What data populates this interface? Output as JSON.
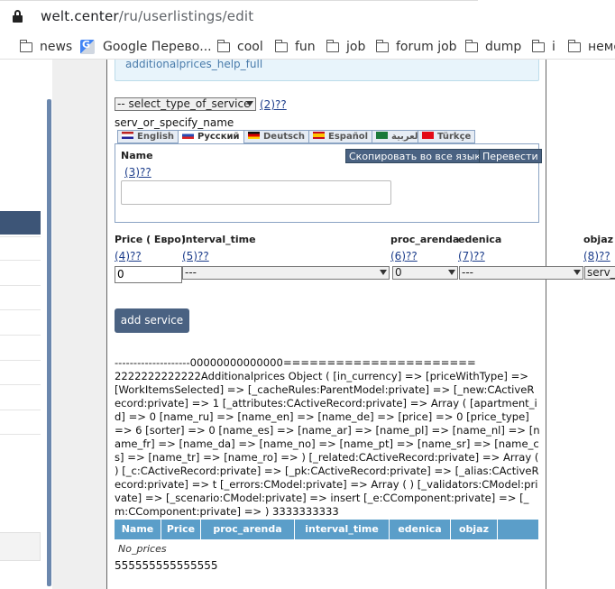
{
  "browser": {
    "url_host": "welt.center",
    "url_path": "/ru/userlistings/edit",
    "bookmarks": [
      {
        "label": "news",
        "icon": "folder-icon"
      },
      {
        "label": "Google Перево...",
        "icon": "google-translate-icon"
      },
      {
        "label": "cool",
        "icon": "folder-icon"
      },
      {
        "label": "fun",
        "icon": "folder-icon"
      },
      {
        "label": "job",
        "icon": "folder-icon"
      },
      {
        "label": "forum job",
        "icon": "folder-icon"
      },
      {
        "label": "dump",
        "icon": "folder-icon"
      },
      {
        "label": "i",
        "icon": "folder-icon"
      },
      {
        "label": "неме",
        "icon": "folder-icon"
      }
    ]
  },
  "form": {
    "help_text": "additionalprices_help_full",
    "service_select": "-- select_type_of_service",
    "service_hint": "(2)??",
    "serv_or_specify": "serv_or_specify_name",
    "tabs": [
      {
        "label": "English",
        "flag": "gb"
      },
      {
        "label": "Русский",
        "flag": "ru",
        "active": true
      },
      {
        "label": "Deutsch",
        "flag": "de"
      },
      {
        "label": "Español",
        "flag": "es"
      },
      {
        "label": "العربية",
        "flag": "sa"
      },
      {
        "label": "Türkçe",
        "flag": "tr"
      }
    ],
    "name_label": "Name",
    "copy_all_btn": "Скопировать во все языки",
    "translate_btn": "Перевести",
    "name_hint": "(3)??",
    "name_value": "",
    "columns": {
      "price_label": "Price ( Евро)",
      "price_hint": "(4)??",
      "price_value": "0",
      "interval_label": "interval_time",
      "interval_hint": "(5)??",
      "interval_value": "---",
      "arenda_label": "proc_arenda",
      "arenda_hint": "(6)??",
      "arenda_value": "0",
      "edenica_label": "edenica",
      "edenica_hint": "(7)??",
      "edenica_value": "---",
      "objaz_label": "objaz",
      "objaz_hint": "(8)??",
      "objaz_value": "serv_"
    },
    "add_service_btn": "add service"
  },
  "debug_dump": "--------------------00000000000000======================\n2222222222222Additionalprices Object ( [in_currency] => [priceWithType] => [WorkItemsSelected] => [_cacheRules:ParentModel:private] => [_new:CActiveRecord:private] => 1 [_attributes:CActiveRecord:private] => Array ( [apartment_id] => 0 [name_ru] => [name_en] => [name_de] => [price] => 0 [price_type] => 6 [sorter] => 0 [name_es] => [name_ar] => [name_pl] => [name_nl] => [name_fr] => [name_da] => [name_no] => [name_pt] => [name_sr] => [name_cs] => [name_tr] => [name_ro] => ) [_related:CActiveRecord:private] => Array ( ) [_c:CActiveRecord:private] => [_pk:CActiveRecord:private] => [_alias:CActiveRecord:private] => t [_errors:CModel:private] => Array ( ) [_validators:CModel:private] => [_scenario:CModel:private] => insert [_e:CComponent:private] => [_m:CComponent:private] => ) 3333333333",
  "grid": {
    "headers": [
      "Name",
      "Price",
      "proc_arenda",
      "interval_time",
      "edenica",
      "objaz",
      ""
    ],
    "empty_text": "No_prices"
  },
  "footer_number": "555555555555555",
  "colors": {
    "accent_dark": "#4a6282",
    "grid_header": "#5b9ec9",
    "link": "#1a3b8a"
  }
}
